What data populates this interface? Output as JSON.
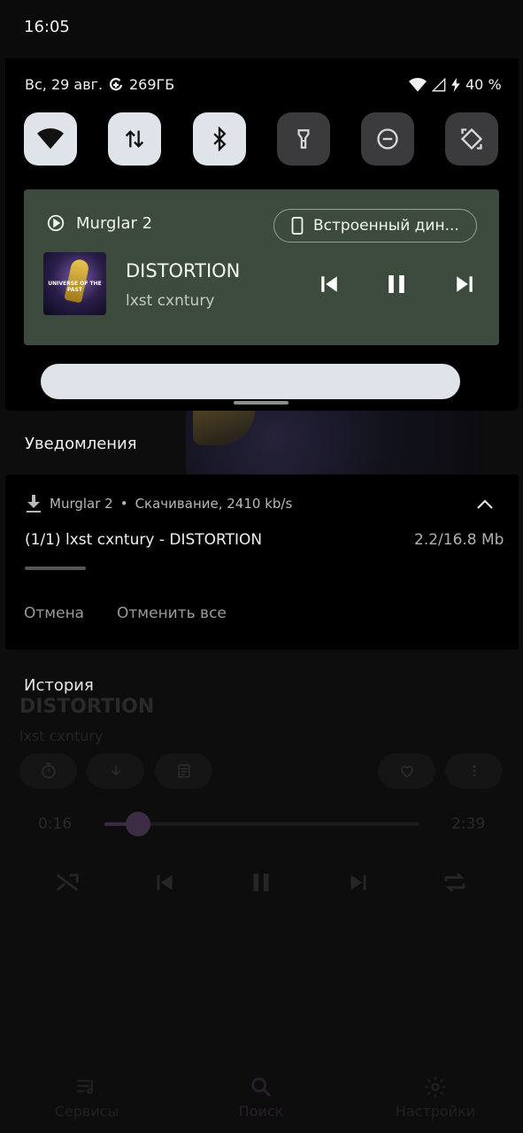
{
  "status_bar": {
    "time": "16:05"
  },
  "quick_settings": {
    "date": "Вс, 29 авг.",
    "data_saver": "269ГБ",
    "battery": "40 %",
    "tiles": [
      {
        "name": "wifi",
        "state": "on"
      },
      {
        "name": "mobile-data",
        "state": "on"
      },
      {
        "name": "bluetooth",
        "state": "on"
      },
      {
        "name": "flashlight",
        "state": "off"
      },
      {
        "name": "do-not-disturb",
        "state": "off"
      },
      {
        "name": "auto-rotate",
        "state": "off"
      }
    ]
  },
  "media": {
    "app_name": "Murglar 2",
    "output_device": "Встроенный дин...",
    "title": "DISTORTION",
    "artist": "lxst cxntury",
    "cover_text": "UNIVERSE OF THE PAST",
    "accent_color": "#3c4b3d"
  },
  "notifications": {
    "header": "Уведомления",
    "download": {
      "app": "Murglar 2",
      "separator": "•",
      "status": "Скачивание, 2410 kb/s",
      "title": "(1/1) lxst cxntury - DISTORTION",
      "size": "2.2/16.8 Mb",
      "actions": [
        "Отмена",
        "Отменить все"
      ]
    },
    "history": "История"
  },
  "background_app": {
    "title": "DISTORTION",
    "artist": "lxst cxntury",
    "time_current": "0:16",
    "time_total": "2:39",
    "nav": [
      "Сервисы",
      "Поиск",
      "Настройки"
    ]
  }
}
